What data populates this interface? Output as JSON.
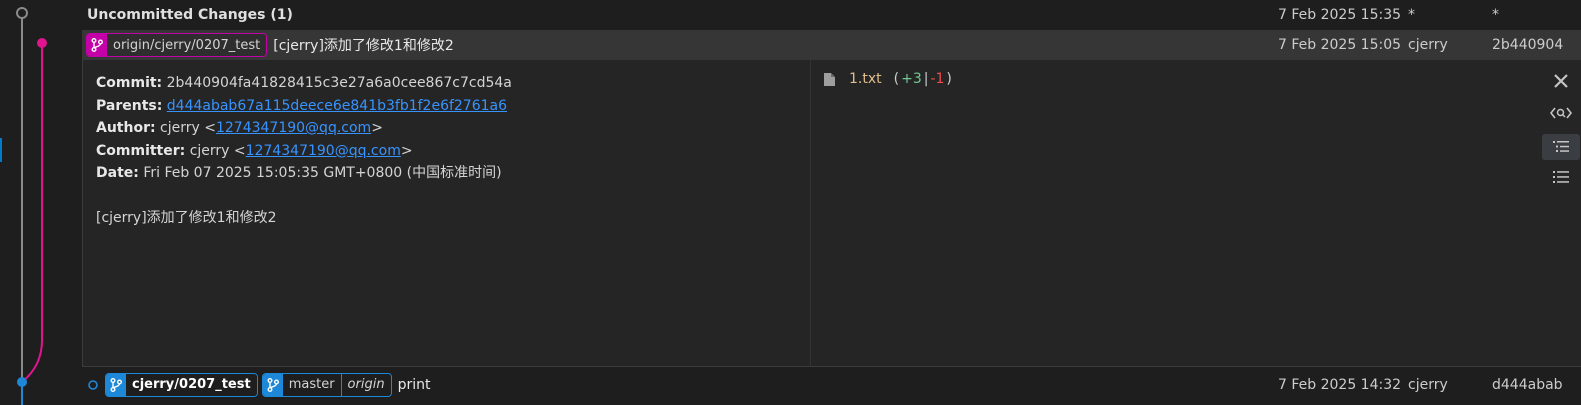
{
  "uncommitted": {
    "title": "Uncommitted Changes (1)",
    "date": "7 Feb 2025 15:35",
    "author": "*",
    "hash": "*"
  },
  "selected_commit": {
    "ref_label": "origin/cjerry/0207_test",
    "message": "[cjerry]添加了修改1和修改2",
    "date": "7 Feb 2025 15:05",
    "author": "cjerry",
    "hash": "2b440904"
  },
  "details": {
    "commit_label": "Commit:",
    "commit_value": "2b440904fa41828415c3e27a6a0cee867c7cd54a",
    "parents_label": "Parents:",
    "parents_value": "d444abab67a115deece6e841b3fb1f2e6f2761a6",
    "author_label": "Author:",
    "author_name": "cjerry <",
    "author_email": "1274347190@qq.com",
    "author_close": ">",
    "committer_label": "Committer:",
    "committer_name": "cjerry <",
    "committer_email": "1274347190@qq.com",
    "committer_close": ">",
    "date_label": "Date:",
    "date_value": "Fri Feb 07 2025 15:05:35 GMT+0800 (中国标准时间)",
    "message": "[cjerry]添加了修改1和修改2"
  },
  "files": [
    {
      "name": "1.txt",
      "open": "(",
      "additions": "+3",
      "sep": "|",
      "deletions": "-1",
      "close": ")"
    }
  ],
  "bottom_commit": {
    "ref_local": "cjerry/0207_test",
    "ref_master": "master",
    "ref_remote": "origin",
    "message": "print",
    "date": "7 Feb 2025 14:32",
    "author": "cjerry",
    "hash": "d444abab"
  },
  "colors": {
    "graph_gray": "#8a8a8a",
    "graph_magenta": "#e0148c",
    "graph_blue": "#1e88d8",
    "link": "#3794ff",
    "file_name": "#e2c08d",
    "additions": "#73c991",
    "deletions": "#f14c4c"
  },
  "toolbar_icons": [
    "close-icon",
    "search-icon",
    "tree-view-icon",
    "list-view-icon"
  ]
}
